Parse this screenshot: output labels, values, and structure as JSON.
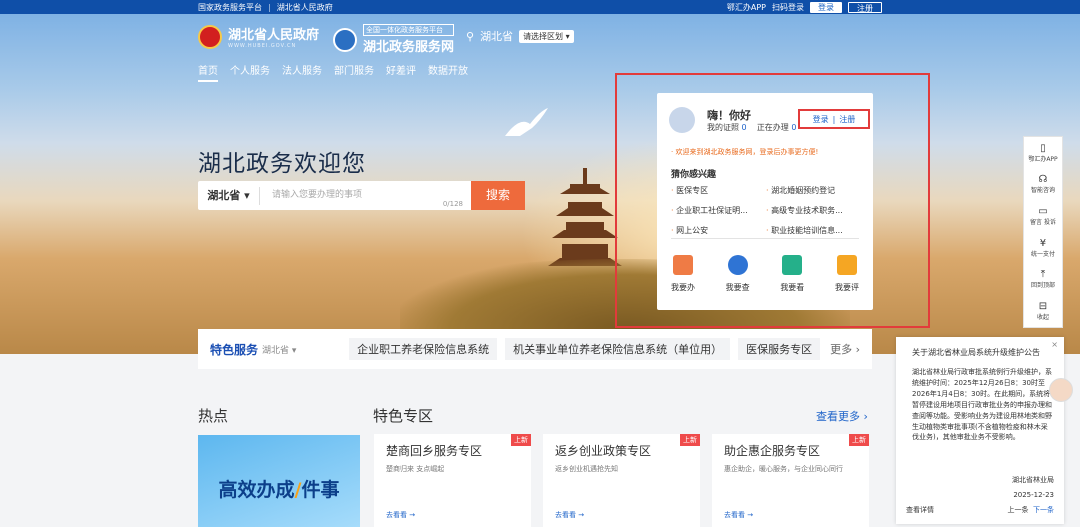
{
  "topbar": {
    "left1": "国家政务服务平台",
    "left2": "湖北省人民政府",
    "app": "鄂汇办APP",
    "scan": "扫码登录",
    "login": "登录",
    "register": "注册"
  },
  "logos": {
    "gov_title": "湖北省人民政府",
    "gov_sub": "WWW.HUBEI.GOV.CN",
    "svc_small": "全国一体化政务服务平台",
    "svc_title": "湖北政务服务网"
  },
  "region": {
    "name": "湖北省",
    "select": "请选择区划 ▾"
  },
  "nav": [
    "首页",
    "个人服务",
    "法人服务",
    "部门服务",
    "好差评",
    "数据开放"
  ],
  "welcome": "湖北政务欢迎您",
  "search": {
    "prov": "湖北省 ▾",
    "placeholder": "请输入您要办理的事项",
    "count": "0/128",
    "button": "搜索"
  },
  "user_card": {
    "greet": "嗨！你好",
    "certs_label": "我的证照",
    "certs": "0",
    "doing_label": "正在办理",
    "doing": "0",
    "login": "登录",
    "register": "注册",
    "tip": "· 欢迎来到湖北政务服务网，登录后办事更方便!",
    "interest": "猜你感兴趣",
    "items": [
      "医保专区",
      "湖北婚姻预约登记",
      "企业职工社保证明...",
      "高级专业技术职务...",
      "网上公安",
      "职业技能培训信息..."
    ],
    "actions": [
      "我要办",
      "我要查",
      "我要看",
      "我要评"
    ]
  },
  "sidebar": [
    "鄂汇办APP",
    "智能咨询",
    "留言 投诉",
    "统一支付",
    "回到顶部",
    "收起"
  ],
  "featured": {
    "title": "特色服务",
    "prov": "湖北省 ▾",
    "items": [
      "企业职工养老保险信息系统",
      "机关事业单位养老保险信息系统（单位用）",
      "医保服务专区"
    ],
    "more": "更多 ›"
  },
  "sections": {
    "hot": "热点",
    "zone": "特色专区",
    "see_more": "查看更多 ›"
  },
  "banner": {
    "a": "高效办成",
    "b": "件事"
  },
  "zones": [
    {
      "title": "楚商回乡服务专区",
      "desc": "楚商归来 支点崛起",
      "go": "去看看 →",
      "tag": "上新"
    },
    {
      "title": "返乡创业政策专区",
      "desc": "返乡创业机遇抢先知",
      "go": "去看看 →",
      "tag": "上新"
    },
    {
      "title": "助企惠企服务专区",
      "desc": "惠企助企，暖心服务，与企业同心同行",
      "go": "去看看 →",
      "tag": "上新"
    }
  ],
  "notice": {
    "title": "关于湖北省林业局系统升级维护公告",
    "close": "×",
    "body": "湖北省林业局行政审批系统例行升级维护，系统维护时间：2025年12月26日8：30时至2026年1月4日8：30时。在此期间，系统将暂停建设用地项目行政审批业务的申报办理和查阅等功能。受影响业务为建设用林地类和野生动植物类审批事项(不含植物检疫和林木采伐业务)，其他审批业务不受影响。",
    "org": "湖北省林业局",
    "date": "2025-12-23",
    "detail": "查看详情",
    "prev": "上一条",
    "next": "下一条"
  }
}
